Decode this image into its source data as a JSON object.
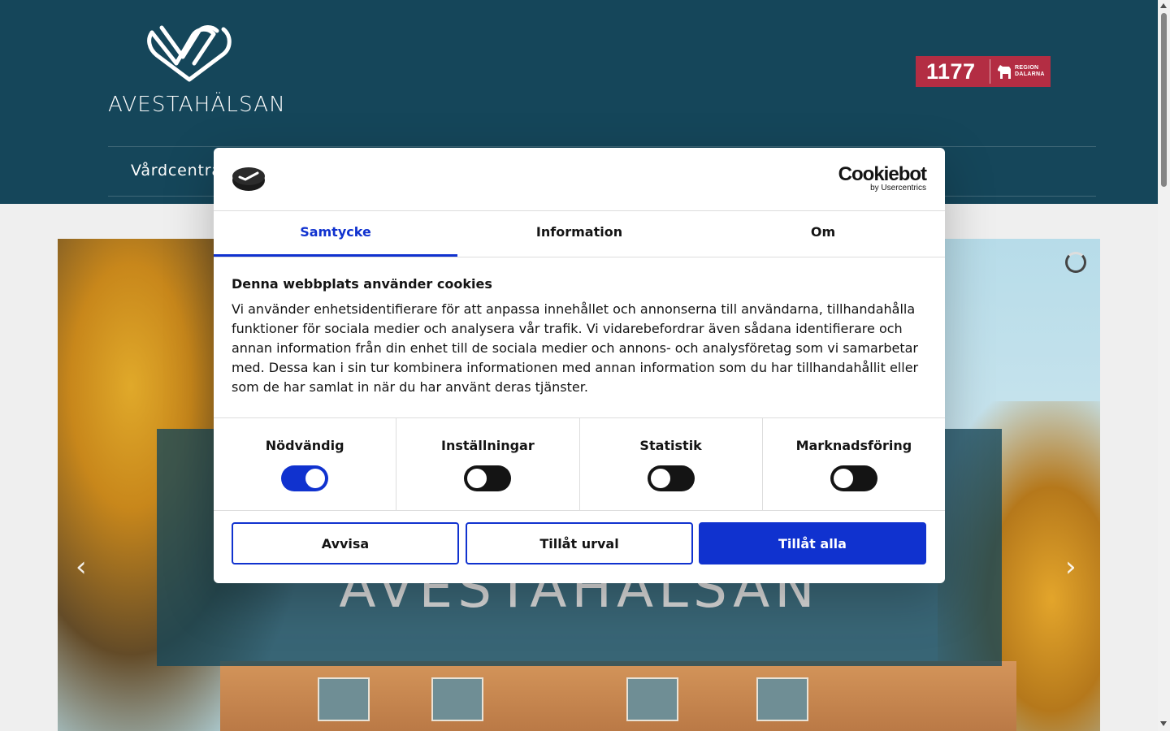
{
  "header": {
    "logo_text": "AVESTAHÄLSAN",
    "badge_number": "1177",
    "badge_region_line1": "REGION",
    "badge_region_line2": "DALARNA",
    "nav_item": "Vårdcentral"
  },
  "hero": {
    "title": "AVESTAHÄLSAN"
  },
  "cookie_dialog": {
    "brand_name": "Cookiebot",
    "brand_sub": "by Usercentrics",
    "tabs": [
      {
        "label": "Samtycke",
        "active": true
      },
      {
        "label": "Information",
        "active": false
      },
      {
        "label": "Om",
        "active": false
      }
    ],
    "heading": "Denna webbplats använder cookies",
    "body": "Vi använder enhetsidentifierare för att anpassa innehållet och annonserna till användarna, tillhandahålla funktioner för sociala medier och analysera vår trafik. Vi vidarebefordrar även sådana identifierare och annan information från din enhet till de sociala medier och annons- och analysföretag som vi samarbetar med. Dessa kan i sin tur kombinera informationen med annan information som du har tillhandahållit eller som de har samlat in när du har använt deras tjänster.",
    "toggles": [
      {
        "label": "Nödvändig",
        "checked": true
      },
      {
        "label": "Inställningar",
        "checked": false
      },
      {
        "label": "Statistik",
        "checked": false
      },
      {
        "label": "Marknadsföring",
        "checked": false
      }
    ],
    "buttons": {
      "reject": "Avvisa",
      "allow_selection": "Tillåt urval",
      "allow_all": "Tillåt alla"
    }
  },
  "colors": {
    "header_bg": "#15465a",
    "accent": "#1032cf",
    "badge_bg": "#b32d43"
  }
}
